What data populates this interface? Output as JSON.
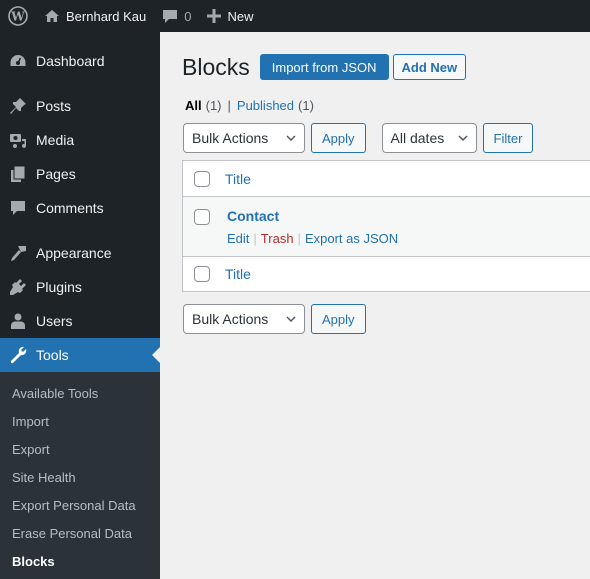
{
  "admin_bar": {
    "site_name": "Bernhard Kau",
    "comments_count": "0",
    "new_label": "New"
  },
  "sidebar": {
    "items": [
      {
        "label": "Dashboard",
        "icon": "dashboard-icon"
      },
      {
        "label": "Posts",
        "icon": "pin-icon"
      },
      {
        "label": "Media",
        "icon": "media-icon"
      },
      {
        "label": "Pages",
        "icon": "pages-icon"
      },
      {
        "label": "Comments",
        "icon": "comment-icon"
      },
      {
        "label": "Appearance",
        "icon": "brush-icon"
      },
      {
        "label": "Plugins",
        "icon": "plug-icon"
      },
      {
        "label": "Users",
        "icon": "user-icon"
      },
      {
        "label": "Tools",
        "icon": "wrench-icon",
        "active": true
      }
    ],
    "submenu": [
      {
        "label": "Available Tools"
      },
      {
        "label": "Import"
      },
      {
        "label": "Export"
      },
      {
        "label": "Site Health"
      },
      {
        "label": "Export Personal Data"
      },
      {
        "label": "Erase Personal Data"
      },
      {
        "label": "Blocks",
        "current": true
      }
    ]
  },
  "main": {
    "title": "Blocks",
    "import_button": "Import from JSON",
    "add_new_button": "Add New",
    "filters": {
      "all_label": "All",
      "all_count": "(1)",
      "separator": "|",
      "published_label": "Published",
      "published_count": "(1)"
    },
    "top_nav": {
      "bulk_actions": "Bulk Actions",
      "apply": "Apply",
      "dates": "All dates",
      "filter": "Filter"
    },
    "table": {
      "header_title": "Title",
      "footer_title": "Title",
      "rows": [
        {
          "title": "Contact",
          "actions": [
            "Edit",
            "Trash",
            "Export as JSON"
          ]
        }
      ]
    },
    "bottom_nav": {
      "bulk_actions": "Bulk Actions",
      "apply": "Apply"
    }
  },
  "colors": {
    "accent": "#2271b1",
    "adminbar_bg": "#1d2327",
    "submenu_bg": "#2c3338",
    "trash": "#b32d2e"
  }
}
